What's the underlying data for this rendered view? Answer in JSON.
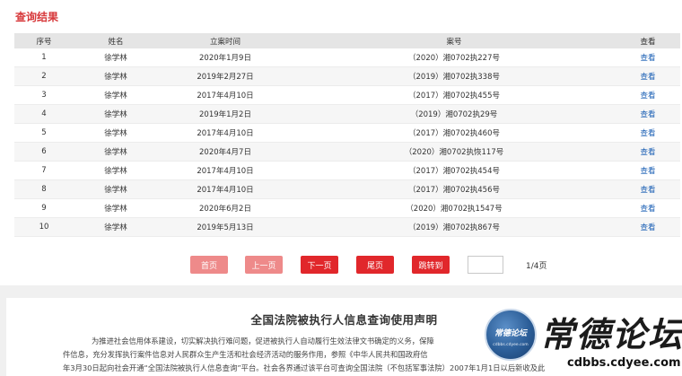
{
  "results": {
    "title": "查询结果",
    "columns": [
      "序号",
      "姓名",
      "立案时间",
      "案号",
      "查看"
    ],
    "rows": [
      {
        "no": "1",
        "name": "徐学林",
        "date": "2020年1月9日",
        "case_no": "（2020）湘0702执227号",
        "view": "查看"
      },
      {
        "no": "2",
        "name": "徐学林",
        "date": "2019年2月27日",
        "case_no": "（2019）湘0702执338号",
        "view": "查看"
      },
      {
        "no": "3",
        "name": "徐学林",
        "date": "2017年4月10日",
        "case_no": "（2017）湘0702执455号",
        "view": "查看"
      },
      {
        "no": "4",
        "name": "徐学林",
        "date": "2019年1月2日",
        "case_no": "（2019）湘0702执29号",
        "view": "查看"
      },
      {
        "no": "5",
        "name": "徐学林",
        "date": "2017年4月10日",
        "case_no": "（2017）湘0702执460号",
        "view": "查看"
      },
      {
        "no": "6",
        "name": "徐学林",
        "date": "2020年4月7日",
        "case_no": "（2020）湘0702执恢117号",
        "view": "查看"
      },
      {
        "no": "7",
        "name": "徐学林",
        "date": "2017年4月10日",
        "case_no": "（2017）湘0702执454号",
        "view": "查看"
      },
      {
        "no": "8",
        "name": "徐学林",
        "date": "2017年4月10日",
        "case_no": "（2017）湘0702执456号",
        "view": "查看"
      },
      {
        "no": "9",
        "name": "徐学林",
        "date": "2020年6月2日",
        "case_no": "（2020）湘0702执1547号",
        "view": "查看"
      },
      {
        "no": "10",
        "name": "徐学林",
        "date": "2019年5月13日",
        "case_no": "（2019）湘0702执867号",
        "view": "查看"
      }
    ]
  },
  "pager": {
    "first": "首页",
    "prev": "上一页",
    "next": "下一页",
    "last": "尾页",
    "jump": "跳转到",
    "page_input_value": "",
    "page_count": "1/4页"
  },
  "notice": {
    "title": "全国法院被执行人信息查询使用声明",
    "line1": "为推进社会信用体系建设，切实解决执行难问题，促进被执行人自动履行生效法律文书确定的义务，保障",
    "line2": "件信息，充分发挥执行案件信息对人民群众生产生活和社会经济活动的服务作用，参照《中华人民共和国政府信",
    "line3": "年3月30日起向社会开通“全国法院被执行人信息查询”平台。社会各界通过该平台可查询全国法院（不包括军事法院）2007年1月1日以后新收及此"
  },
  "watermark": {
    "logo_text": "常德论坛",
    "logo_ring": "cdbbs.cdyee.com",
    "name": "常德论坛",
    "url": "cdbbs.cdyee.com"
  },
  "colors": {
    "accent_red": "#e1272b",
    "disabled_red": "#ee8a8a",
    "title_red": "#d7383a",
    "link_blue": "#1a5fb4"
  }
}
